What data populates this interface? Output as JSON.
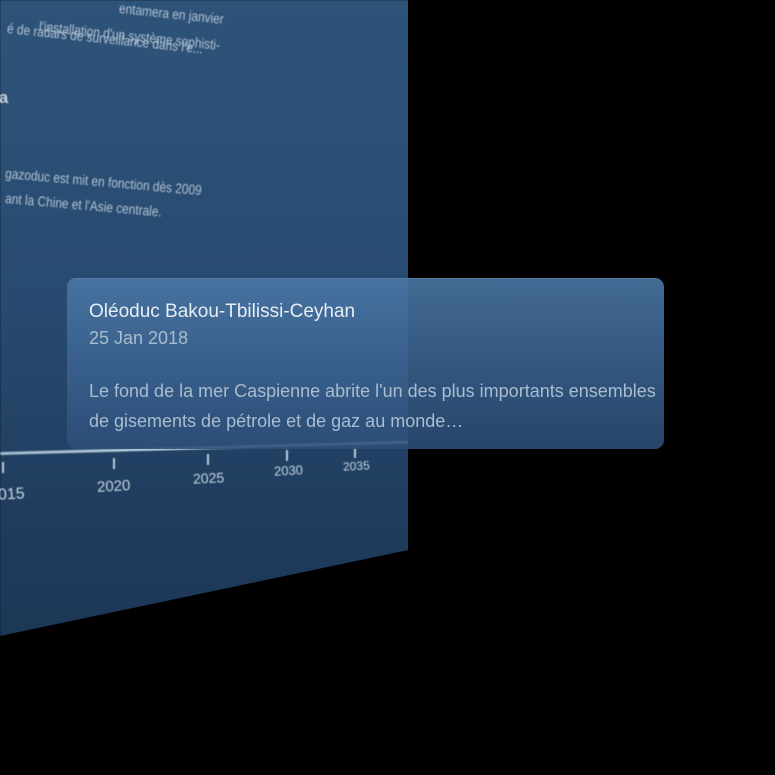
{
  "background_panel": {
    "text_lines": [
      "entamera en janvier",
      "l'installation d'un système sophisti-",
      "é de radars de surveillance dans l'e...",
      "ia",
      "gazoduc est mit en fonction dès 2009",
      "ant la Chine et l'Asie centrale."
    ]
  },
  "timeline": {
    "tick_labels": [
      "015",
      "2020",
      "2025",
      "2030",
      "2035"
    ]
  },
  "tooltip": {
    "title": "Oléoduc Bakou-Tbilissi-Ceyhan",
    "date": "25 Jan 2018",
    "description": "Le fond de la mer Caspienne abrite l'un des plus importants ensembles de gisements de pétrole et de gaz au monde…"
  }
}
